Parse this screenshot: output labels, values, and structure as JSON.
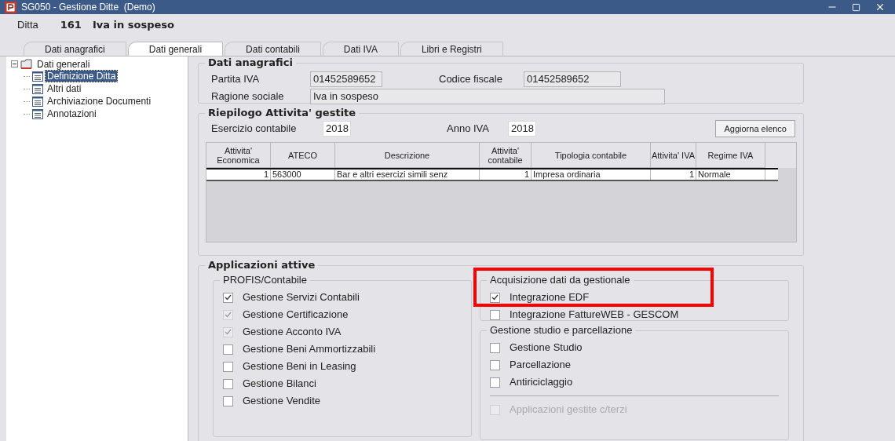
{
  "window": {
    "title": "SG050 - Gestione Ditte  (Demo)"
  },
  "ditta": {
    "label": "Ditta",
    "code": "161",
    "name": "Iva in sospeso"
  },
  "tabs": [
    {
      "label": "Dati anagrafici",
      "selected": false
    },
    {
      "label": "Dati generali",
      "selected": true
    },
    {
      "label": "Dati contabili",
      "selected": false
    },
    {
      "label": "Dati IVA",
      "selected": false
    },
    {
      "label": "Libri e Registri",
      "selected": false
    }
  ],
  "tree": {
    "label": "Dati generali",
    "expanded": true,
    "children": [
      {
        "label": "Definizione Ditta",
        "selected": true
      },
      {
        "label": "Altri dati",
        "selected": false
      },
      {
        "label": "Archiviazione Documenti",
        "selected": false
      },
      {
        "label": "Annotazioni",
        "selected": false
      }
    ]
  },
  "dati_anagrafici": {
    "title": "Dati anagrafici",
    "fields": [
      {
        "label": "Partita IVA",
        "value": "01452589652"
      },
      {
        "label": "Codice fiscale",
        "value": "01452589652"
      },
      {
        "label": "Ragione sociale",
        "value": "Iva in sospeso"
      }
    ]
  },
  "riepilogo": {
    "title": "Riepilogo Attivita' gestite",
    "esercizio": {
      "label": "Esercizio contabile",
      "value": "2018"
    },
    "anno_iva": {
      "label": "Anno IVA",
      "value": "2018"
    },
    "button": "Aggiorna elenco",
    "table": {
      "columns": [
        {
          "label": "Attivita' Economica",
          "kind": "number"
        },
        {
          "label": "ATECO",
          "kind": "text"
        },
        {
          "label": "Descrizione",
          "kind": "text"
        },
        {
          "label": "Attivita' contabile",
          "kind": "number"
        },
        {
          "label": "Tipologia contabile",
          "kind": "text"
        },
        {
          "label": "Attivita' IVA",
          "kind": "number"
        },
        {
          "label": "Regime IVA",
          "kind": "text"
        }
      ],
      "rows": [
        [
          "1",
          "563000",
          "Bar e altri esercizi simili senz",
          "1",
          "Impresa ordinaria",
          "1",
          "Normale"
        ]
      ]
    }
  },
  "applicazioni": {
    "title": "Applicazioni attive",
    "groups": [
      {
        "title": "PROFIS/Contabile",
        "highlighted": false,
        "items": [
          {
            "label": "Gestione Servizi Contabili",
            "checked": true,
            "disabled": false
          },
          {
            "label": "Gestione Certificazione",
            "checked": true,
            "disabled": true
          },
          {
            "label": "Gestione Acconto IVA",
            "checked": true,
            "disabled": true
          },
          {
            "label": "Gestione Beni Ammortizzabili",
            "checked": false,
            "disabled": false
          },
          {
            "label": "Gestione Beni in Leasing",
            "checked": false,
            "disabled": false
          },
          {
            "label": "Gestione Bilanci",
            "checked": false,
            "disabled": false
          },
          {
            "label": "Gestione Vendite",
            "checked": false,
            "disabled": false
          }
        ]
      },
      {
        "title": "Acquisizione dati da gestionale",
        "highlighted": true,
        "items": [
          {
            "label": "Integrazione EDF",
            "checked": true,
            "disabled": false
          },
          {
            "label": "Integrazione FattureWEB - GESCOM",
            "checked": false,
            "disabled": false
          }
        ]
      },
      {
        "title": "Gestione studio e parcellazione",
        "highlighted": false,
        "items": [
          {
            "label": "Gestione Studio",
            "checked": false,
            "disabled": false
          },
          {
            "label": "Parcellazione",
            "checked": false,
            "disabled": false
          },
          {
            "label": "Antiriciclaggio",
            "checked": false,
            "disabled": false
          }
        ],
        "footer_items": [
          {
            "label": "Applicazioni gestite c/terzi",
            "checked": false,
            "disabled": true
          }
        ]
      }
    ]
  }
}
